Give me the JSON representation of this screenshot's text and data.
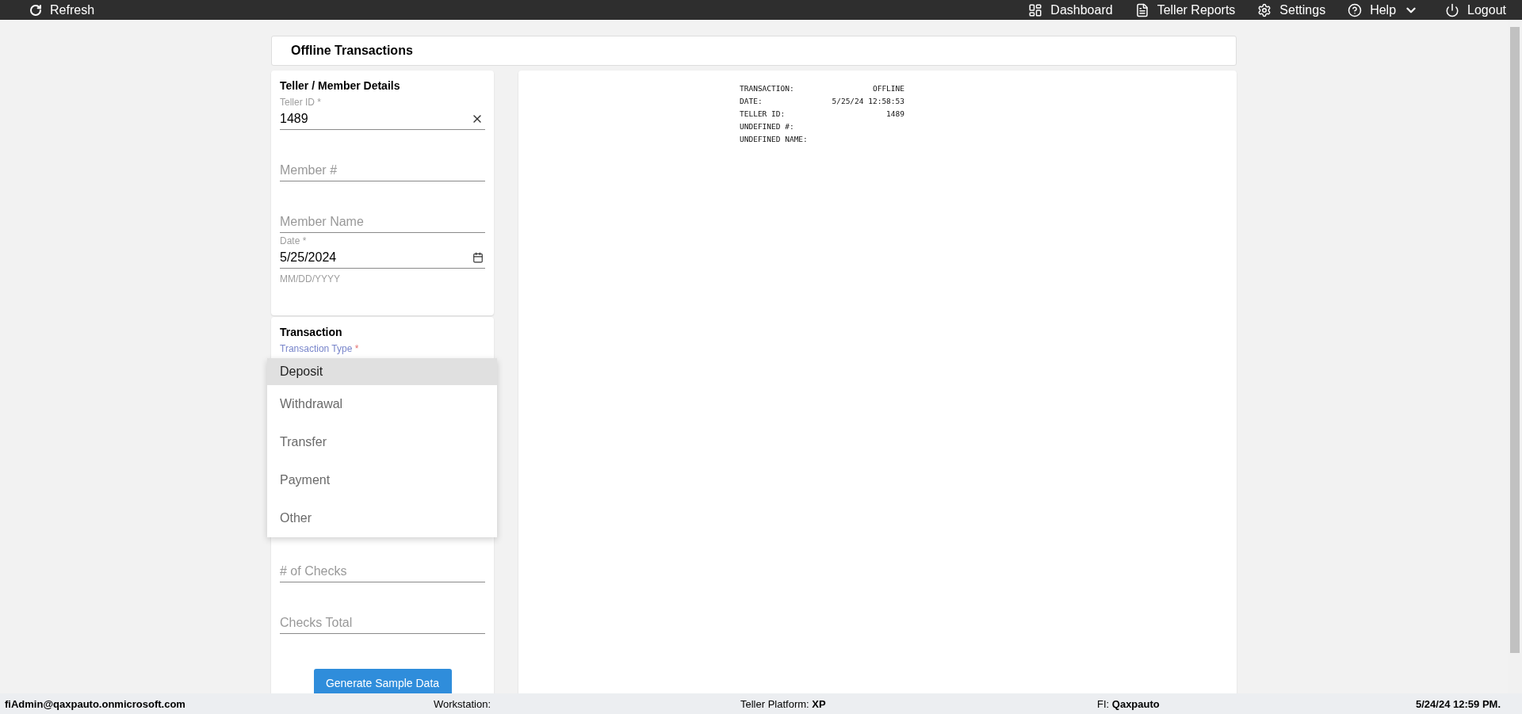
{
  "top_bar": {
    "left": [
      {
        "label": "Refresh",
        "has_menu": false
      }
    ],
    "right": [
      {
        "label": "Dashboard",
        "has_menu": false
      },
      {
        "label": "Teller Reports",
        "has_menu": false
      },
      {
        "label": "Settings",
        "has_menu": false
      },
      {
        "label": "Help",
        "has_menu": true
      },
      {
        "label": "Logout",
        "has_menu": false
      }
    ]
  },
  "page_title": "Offline Transactions",
  "details_card": {
    "title": "Teller / Member Details",
    "fields": [
      {
        "kind": "clearable",
        "label": "Teller ID",
        "required_mark": "*",
        "value": "1489"
      },
      {
        "kind": "text",
        "placeholder": "Member #"
      },
      {
        "kind": "text",
        "placeholder": "Member Name"
      },
      {
        "kind": "date",
        "label": "Date",
        "required_mark": "*",
        "value": "5/25/2024",
        "helper": "MM/DD/YYYY"
      }
    ]
  },
  "transaction_card": {
    "title": "Transaction",
    "fields": [
      {
        "kind": "select",
        "label": "Transaction Type",
        "required_mark": "*",
        "focused": true
      },
      {
        "kind": "text",
        "placeholder": "# of Checks"
      },
      {
        "kind": "text",
        "placeholder": "Checks Total"
      }
    ],
    "button": "Generate Sample Data"
  },
  "type_menu": {
    "options": [
      {
        "label": "Deposit",
        "selected": true
      },
      {
        "label": "Withdrawal",
        "selected": false
      },
      {
        "label": "Transfer",
        "selected": false
      },
      {
        "label": "Payment",
        "selected": false
      },
      {
        "label": "Other",
        "selected": false
      }
    ]
  },
  "receipt": {
    "lines": [
      {
        "label": "TRANSACTION:",
        "value": "OFFLINE"
      },
      {
        "label": "DATE:",
        "value": "5/25/24 12:58:53"
      },
      {
        "label": "TELLER ID:",
        "value": "1489"
      },
      {
        "label": "UNDEFINED #:"
      },
      {
        "label": "UNDEFINED NAME:"
      }
    ]
  },
  "status_bar": {
    "user": "fiAdmin@qaxpauto.onmicrosoft.com",
    "items": [
      {
        "label": "Workstation:"
      },
      {
        "label": "Teller Platform:",
        "value": "XP"
      },
      {
        "label": "FI:",
        "value": "Qaxpauto"
      }
    ],
    "datetime": "5/24/24 12:59 PM."
  }
}
